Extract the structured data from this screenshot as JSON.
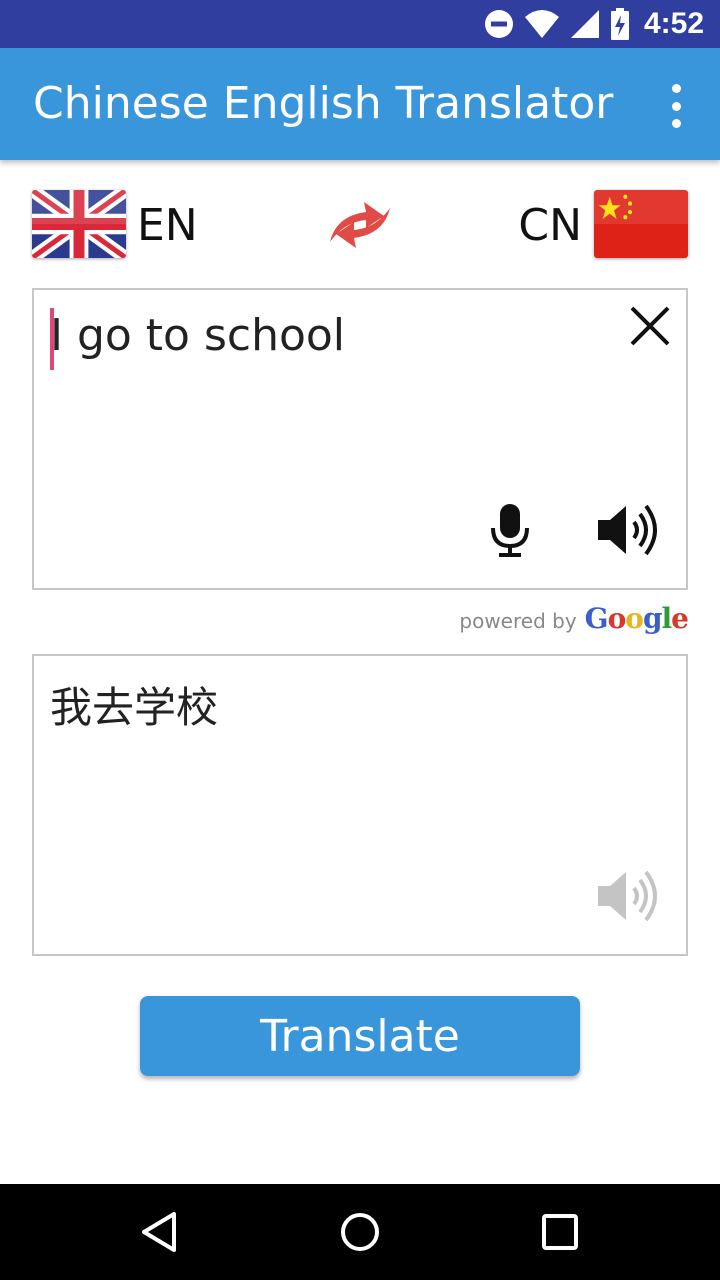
{
  "status_bar": {
    "time": "4:52",
    "icons": [
      "do-not-disturb-icon",
      "wifi-icon",
      "cell-signal-icon",
      "battery-charging-icon"
    ]
  },
  "app_bar": {
    "title": "Chinese English Translator",
    "menu_icon": "more-vert-icon"
  },
  "languages": {
    "source": {
      "code": "EN",
      "flag": "uk-flag"
    },
    "target": {
      "code": "CN",
      "flag": "china-flag"
    },
    "swap_icon": "swap-arrows-icon"
  },
  "input": {
    "value": "I go to school",
    "clear_icon": "close-icon",
    "mic_icon": "microphone-icon",
    "speak_icon": "speaker-icon"
  },
  "attribution": {
    "label": "powered by",
    "brand": [
      "G",
      "o",
      "o",
      "g",
      "l",
      "e"
    ],
    "brand_colors": [
      "#3b5fc9",
      "#d8382b",
      "#e8b31c",
      "#3b5fc9",
      "#2f9a3b",
      "#d8382b"
    ]
  },
  "output": {
    "value": "我去学校",
    "speak_icon": "speaker-icon"
  },
  "translate_button": {
    "label": "Translate"
  },
  "colors": {
    "status_bar": "#303f9f",
    "app_bar": "#3a96db",
    "accent": "#3a96db",
    "caret": "#e0457b",
    "swap_arrows": "#e04b47"
  },
  "nav_bar": {
    "back_icon": "back-triangle-icon",
    "home_icon": "home-circle-icon",
    "recents_icon": "recents-square-icon"
  }
}
